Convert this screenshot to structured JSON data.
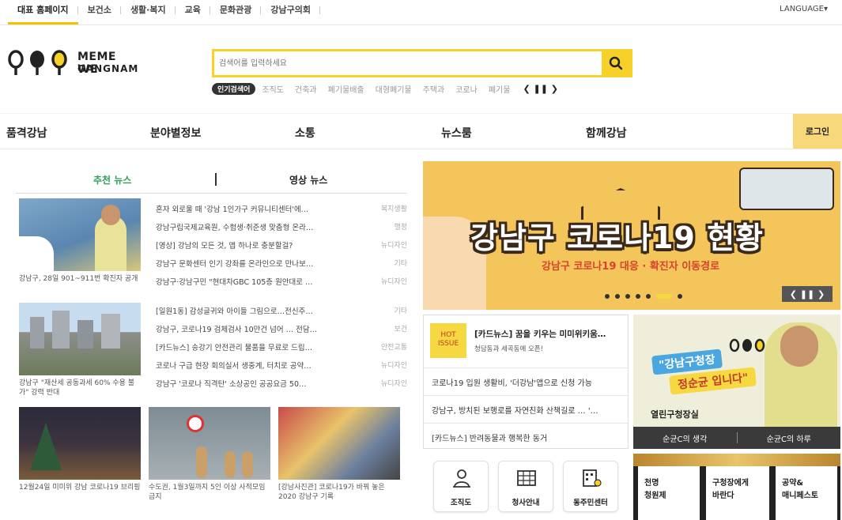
{
  "topnav": {
    "items": [
      "대표 홈페이지",
      "보건소",
      "생활·복지",
      "교육",
      "문화관광",
      "강남구의회"
    ],
    "language": "LANGUAGE▾"
  },
  "logo": {
    "text_top": "MEME WE",
    "text_bottom": "GANGNAM"
  },
  "search": {
    "placeholder": "검색어를 입력하세요",
    "popular_label": "인기검색어",
    "keywords": [
      "조직도",
      "건축과",
      "폐기물배출",
      "대형폐기물",
      "주택과",
      "코로나",
      "폐기물"
    ],
    "controls": "❮ ❚❚ ❯"
  },
  "mainnav": {
    "items": [
      "품격강남",
      "분야별정보",
      "소통",
      "뉴스룸",
      "함께강남"
    ],
    "login": "로그인"
  },
  "news": {
    "tab_recommended": "추천 뉴스",
    "tab_video": "영상 뉴스",
    "thumb_captions": [
      "강남구, 28일 901~911번 확진자 공개",
      "강남구 \"재산세 공동과세 60% 수용 불가\" 강력 반대",
      "12월24일 미미위 강남 코로나19 브리핑",
      "수도권, 1월3일까지 5인 이상 사적모임 금지",
      "[강남사진관] 코로나19가 바꿔 놓은 2020 강남구 기록"
    ],
    "rows": [
      {
        "title": "혼자 외로울 때 '강남 1인가구 커뮤니티센터'에…",
        "category": "복지생활"
      },
      {
        "title": "강남구립국제교육원, 수험생·취준생 맞춤형 온라…",
        "category": "행정"
      },
      {
        "title": "[영상] 강남의 모든 것, 앱 하나로 충분할걸?",
        "category": "뉴디자인"
      },
      {
        "title": "강남구 문화센터 인기 강좌를 온라인으로 만나보…",
        "category": "기타"
      },
      {
        "title": "강남구·강남구민 \"현대차GBC 105층 원안대로 …",
        "category": "뉴디자인"
      },
      {
        "title": "[일원1동] 감성글귀와 아이들 그림으로…전신주…",
        "category": "기타"
      },
      {
        "title": "강남구, 코로나19 검체검사 10만건 넘어 … 전담…",
        "category": "보건"
      },
      {
        "title": "[카드뉴스] 승강기 안전관리 물품을 무료로 드립…",
        "category": "안전교통"
      },
      {
        "title": "코로나 구급 현장 회의실서 생중계, 터치로 공약…",
        "category": "뉴디자인"
      },
      {
        "title": "강남구 '코로나 직격탄' 소상공인 공공요금 50…",
        "category": "뉴디자인"
      }
    ]
  },
  "banner": {
    "title": "강남구 코로나19 현황",
    "subtitle": "강남구 코로나19 대응 · 확진자 이동경로",
    "controls": "❮  ❚❚  ❯"
  },
  "midlist": {
    "hot_label_1": "HOT",
    "hot_label_2": "ISSUE",
    "hot_title": "[카드뉴스] 꿈을 키우는 미미위키움…",
    "hot_sub": "청담동과 세곡동에 오픈!",
    "items": [
      "코로나19 입원 생활비, '더강남'앱으로 신청 가능",
      "강남구, 방치된 보행로를 자연친화 산책길로 … '…",
      "[카드뉴스] 반려동물과 행복한 동거"
    ]
  },
  "mayor": {
    "tag1": "\"강남구청장",
    "tag2": "정순균 입니다\"",
    "room": "열린구청장실",
    "btn1": "순균C의 생각",
    "btn2": "순균C의 하루"
  },
  "quicklinks": [
    "조직도",
    "청사안내",
    "동주민센터"
  ],
  "bottom_cards": [
    "천명\n청원제",
    "구청장에게\n바란다",
    "공약&\n매니페스토"
  ],
  "colors": {
    "brand_yellow": "#f7d12a",
    "green_tab": "#2e9e5b",
    "hot_red": "#c0392b"
  }
}
